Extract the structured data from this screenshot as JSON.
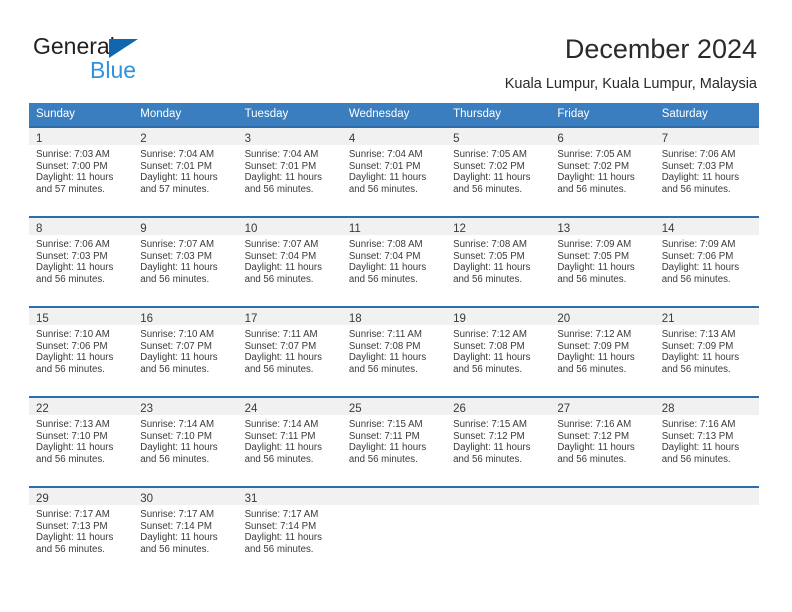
{
  "brand": {
    "name_top": "General",
    "name_bottom": "Blue",
    "triangle_color": "#1266b0",
    "blue_color": "#2f93dd"
  },
  "header": {
    "title": "December 2024",
    "subtitle": "Kuala Lumpur, Kuala Lumpur, Malaysia"
  },
  "colors": {
    "header_row_background": "#3a7ebf",
    "header_row_text": "#ffffff",
    "row_separator": "#2e6da9",
    "daynum_band": "#f1f1f1",
    "body_text": "#3a3a3a"
  },
  "calendar": {
    "weekday_headers": [
      "Sunday",
      "Monday",
      "Tuesday",
      "Wednesday",
      "Thursday",
      "Friday",
      "Saturday"
    ],
    "weeks": [
      [
        {
          "day": "1",
          "sunrise": "Sunrise: 7:03 AM",
          "sunset": "Sunset: 7:00 PM",
          "daylight_line1": "Daylight: 11 hours",
          "daylight_line2": "and 57 minutes."
        },
        {
          "day": "2",
          "sunrise": "Sunrise: 7:04 AM",
          "sunset": "Sunset: 7:01 PM",
          "daylight_line1": "Daylight: 11 hours",
          "daylight_line2": "and 57 minutes."
        },
        {
          "day": "3",
          "sunrise": "Sunrise: 7:04 AM",
          "sunset": "Sunset: 7:01 PM",
          "daylight_line1": "Daylight: 11 hours",
          "daylight_line2": "and 56 minutes."
        },
        {
          "day": "4",
          "sunrise": "Sunrise: 7:04 AM",
          "sunset": "Sunset: 7:01 PM",
          "daylight_line1": "Daylight: 11 hours",
          "daylight_line2": "and 56 minutes."
        },
        {
          "day": "5",
          "sunrise": "Sunrise: 7:05 AM",
          "sunset": "Sunset: 7:02 PM",
          "daylight_line1": "Daylight: 11 hours",
          "daylight_line2": "and 56 minutes."
        },
        {
          "day": "6",
          "sunrise": "Sunrise: 7:05 AM",
          "sunset": "Sunset: 7:02 PM",
          "daylight_line1": "Daylight: 11 hours",
          "daylight_line2": "and 56 minutes."
        },
        {
          "day": "7",
          "sunrise": "Sunrise: 7:06 AM",
          "sunset": "Sunset: 7:03 PM",
          "daylight_line1": "Daylight: 11 hours",
          "daylight_line2": "and 56 minutes."
        }
      ],
      [
        {
          "day": "8",
          "sunrise": "Sunrise: 7:06 AM",
          "sunset": "Sunset: 7:03 PM",
          "daylight_line1": "Daylight: 11 hours",
          "daylight_line2": "and 56 minutes."
        },
        {
          "day": "9",
          "sunrise": "Sunrise: 7:07 AM",
          "sunset": "Sunset: 7:03 PM",
          "daylight_line1": "Daylight: 11 hours",
          "daylight_line2": "and 56 minutes."
        },
        {
          "day": "10",
          "sunrise": "Sunrise: 7:07 AM",
          "sunset": "Sunset: 7:04 PM",
          "daylight_line1": "Daylight: 11 hours",
          "daylight_line2": "and 56 minutes."
        },
        {
          "day": "11",
          "sunrise": "Sunrise: 7:08 AM",
          "sunset": "Sunset: 7:04 PM",
          "daylight_line1": "Daylight: 11 hours",
          "daylight_line2": "and 56 minutes."
        },
        {
          "day": "12",
          "sunrise": "Sunrise: 7:08 AM",
          "sunset": "Sunset: 7:05 PM",
          "daylight_line1": "Daylight: 11 hours",
          "daylight_line2": "and 56 minutes."
        },
        {
          "day": "13",
          "sunrise": "Sunrise: 7:09 AM",
          "sunset": "Sunset: 7:05 PM",
          "daylight_line1": "Daylight: 11 hours",
          "daylight_line2": "and 56 minutes."
        },
        {
          "day": "14",
          "sunrise": "Sunrise: 7:09 AM",
          "sunset": "Sunset: 7:06 PM",
          "daylight_line1": "Daylight: 11 hours",
          "daylight_line2": "and 56 minutes."
        }
      ],
      [
        {
          "day": "15",
          "sunrise": "Sunrise: 7:10 AM",
          "sunset": "Sunset: 7:06 PM",
          "daylight_line1": "Daylight: 11 hours",
          "daylight_line2": "and 56 minutes."
        },
        {
          "day": "16",
          "sunrise": "Sunrise: 7:10 AM",
          "sunset": "Sunset: 7:07 PM",
          "daylight_line1": "Daylight: 11 hours",
          "daylight_line2": "and 56 minutes."
        },
        {
          "day": "17",
          "sunrise": "Sunrise: 7:11 AM",
          "sunset": "Sunset: 7:07 PM",
          "daylight_line1": "Daylight: 11 hours",
          "daylight_line2": "and 56 minutes."
        },
        {
          "day": "18",
          "sunrise": "Sunrise: 7:11 AM",
          "sunset": "Sunset: 7:08 PM",
          "daylight_line1": "Daylight: 11 hours",
          "daylight_line2": "and 56 minutes."
        },
        {
          "day": "19",
          "sunrise": "Sunrise: 7:12 AM",
          "sunset": "Sunset: 7:08 PM",
          "daylight_line1": "Daylight: 11 hours",
          "daylight_line2": "and 56 minutes."
        },
        {
          "day": "20",
          "sunrise": "Sunrise: 7:12 AM",
          "sunset": "Sunset: 7:09 PM",
          "daylight_line1": "Daylight: 11 hours",
          "daylight_line2": "and 56 minutes."
        },
        {
          "day": "21",
          "sunrise": "Sunrise: 7:13 AM",
          "sunset": "Sunset: 7:09 PM",
          "daylight_line1": "Daylight: 11 hours",
          "daylight_line2": "and 56 minutes."
        }
      ],
      [
        {
          "day": "22",
          "sunrise": "Sunrise: 7:13 AM",
          "sunset": "Sunset: 7:10 PM",
          "daylight_line1": "Daylight: 11 hours",
          "daylight_line2": "and 56 minutes."
        },
        {
          "day": "23",
          "sunrise": "Sunrise: 7:14 AM",
          "sunset": "Sunset: 7:10 PM",
          "daylight_line1": "Daylight: 11 hours",
          "daylight_line2": "and 56 minutes."
        },
        {
          "day": "24",
          "sunrise": "Sunrise: 7:14 AM",
          "sunset": "Sunset: 7:11 PM",
          "daylight_line1": "Daylight: 11 hours",
          "daylight_line2": "and 56 minutes."
        },
        {
          "day": "25",
          "sunrise": "Sunrise: 7:15 AM",
          "sunset": "Sunset: 7:11 PM",
          "daylight_line1": "Daylight: 11 hours",
          "daylight_line2": "and 56 minutes."
        },
        {
          "day": "26",
          "sunrise": "Sunrise: 7:15 AM",
          "sunset": "Sunset: 7:12 PM",
          "daylight_line1": "Daylight: 11 hours",
          "daylight_line2": "and 56 minutes."
        },
        {
          "day": "27",
          "sunrise": "Sunrise: 7:16 AM",
          "sunset": "Sunset: 7:12 PM",
          "daylight_line1": "Daylight: 11 hours",
          "daylight_line2": "and 56 minutes."
        },
        {
          "day": "28",
          "sunrise": "Sunrise: 7:16 AM",
          "sunset": "Sunset: 7:13 PM",
          "daylight_line1": "Daylight: 11 hours",
          "daylight_line2": "and 56 minutes."
        }
      ],
      [
        {
          "day": "29",
          "sunrise": "Sunrise: 7:17 AM",
          "sunset": "Sunset: 7:13 PM",
          "daylight_line1": "Daylight: 11 hours",
          "daylight_line2": "and 56 minutes."
        },
        {
          "day": "30",
          "sunrise": "Sunrise: 7:17 AM",
          "sunset": "Sunset: 7:14 PM",
          "daylight_line1": "Daylight: 11 hours",
          "daylight_line2": "and 56 minutes."
        },
        {
          "day": "31",
          "sunrise": "Sunrise: 7:17 AM",
          "sunset": "Sunset: 7:14 PM",
          "daylight_line1": "Daylight: 11 hours",
          "daylight_line2": "and 56 minutes."
        },
        {
          "day": "",
          "sunrise": "",
          "sunset": "",
          "daylight_line1": "",
          "daylight_line2": ""
        },
        {
          "day": "",
          "sunrise": "",
          "sunset": "",
          "daylight_line1": "",
          "daylight_line2": ""
        },
        {
          "day": "",
          "sunrise": "",
          "sunset": "",
          "daylight_line1": "",
          "daylight_line2": ""
        },
        {
          "day": "",
          "sunrise": "",
          "sunset": "",
          "daylight_line1": "",
          "daylight_line2": ""
        }
      ]
    ]
  }
}
